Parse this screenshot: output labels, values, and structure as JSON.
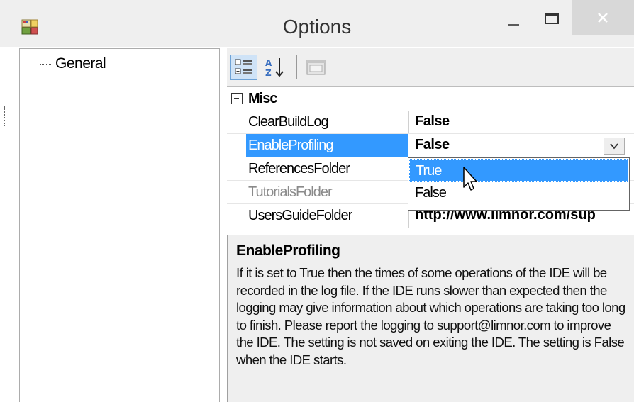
{
  "window": {
    "title": "Options",
    "icons": {
      "app": "app-icon",
      "minimize": "minimize-icon",
      "maximize": "maximize-icon",
      "close": "close-icon"
    }
  },
  "tree": {
    "items": [
      {
        "label": "General"
      }
    ]
  },
  "toolbar": {
    "icons": [
      "categorized-icon",
      "alphabetical-sort-icon",
      "property-pages-icon"
    ],
    "active": "categorized-icon"
  },
  "property_grid": {
    "category": "Misc",
    "rows": [
      {
        "label": "ClearBuildLog",
        "value": "False"
      },
      {
        "label": "EnableProfiling",
        "value": "False"
      },
      {
        "label": "ReferencesFolder",
        "value": ""
      },
      {
        "label": "TutorialsFolder",
        "value": ""
      },
      {
        "label": "UsersGuideFolder",
        "value": "http://www.limnor.com/sup"
      }
    ],
    "selected_row": "EnableProfiling"
  },
  "dropdown": {
    "options": [
      "True",
      "False"
    ],
    "highlighted": "True"
  },
  "help": {
    "title": "EnableProfiling",
    "text": "If it is set to True then the times of some operations of the IDE will be recorded in the log file. If the IDE runs slower than expected then the logging may give information about which operations are taking too long to finish. Please report the logging to support@limnor.com to improve the IDE. The setting is not saved on exiting the IDE. The setting is False when the IDE starts."
  },
  "colors": {
    "selection": "#3399ff",
    "chrome": "#efefef",
    "close_button": "#d8d8d8"
  }
}
